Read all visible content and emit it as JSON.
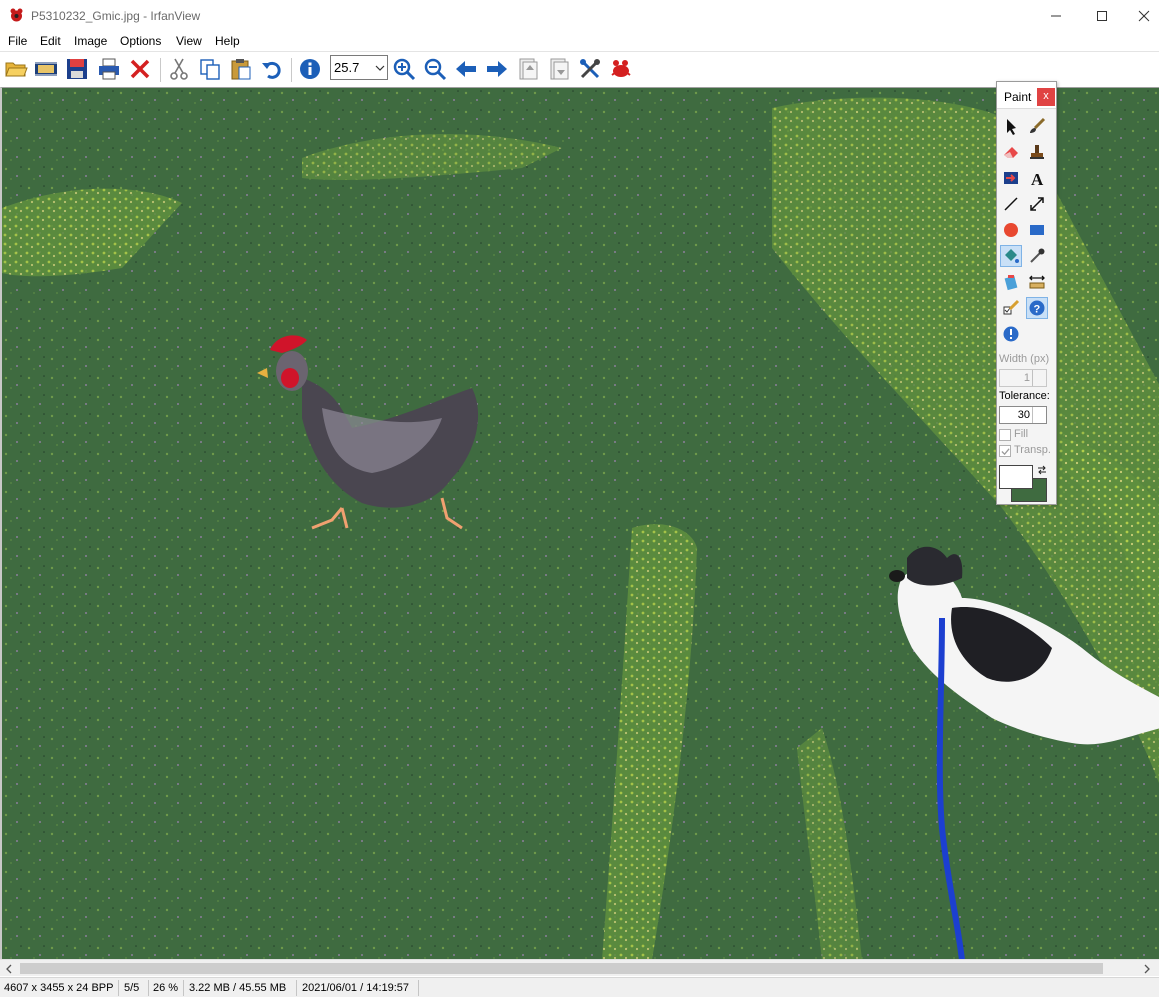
{
  "window": {
    "title": "P5310232_Gmic.jpg - IrfanView"
  },
  "menu": [
    "File",
    "Edit",
    "Image",
    "Options",
    "View",
    "Help"
  ],
  "toolbar": {
    "zoom_value": "25.7",
    "icons": [
      "open-folder-icon",
      "slideshow-icon",
      "save-icon",
      "print-icon",
      "delete-icon",
      "cut-icon",
      "copy-icon",
      "paste-icon",
      "undo-icon",
      "info-icon",
      "zoom-in-icon",
      "zoom-out-icon",
      "previous-icon",
      "next-icon",
      "first-page-icon",
      "last-page-icon",
      "properties-icon",
      "irfanview-logo-icon"
    ]
  },
  "paint": {
    "title": "Paint",
    "close_label": "x",
    "tools": [
      "selection-arrow",
      "brush",
      "eraser",
      "clone-stamp",
      "line-arrow",
      "text",
      "straight-line",
      "resize-arrow",
      "circle",
      "rectangle",
      "fill-bucket",
      "color-picker",
      "magic-wand",
      "measure",
      "pen-check",
      "help",
      "info"
    ],
    "selected_tools": [
      "fill-bucket",
      "help"
    ],
    "width_label": "Width (px)",
    "width_value": "1",
    "tolerance_label": "Tolerance:",
    "tolerance_value": "30",
    "fill_label": "Fill",
    "transp_label": "Transp.",
    "foreground_color": "#ffffff",
    "background_color": "#3f6b40"
  },
  "statusbar": {
    "dimensions": "4607 x 3455 x 24 BPP",
    "page": "5/5",
    "zoom": "26 %",
    "size": "3.22 MB / 45.55 MB",
    "datetime": "2021/06/01 / 14:19:57"
  },
  "colors": {
    "grass": "#3f6b40",
    "accent_blue": "#1c5fb8",
    "close_red": "#e04343"
  }
}
